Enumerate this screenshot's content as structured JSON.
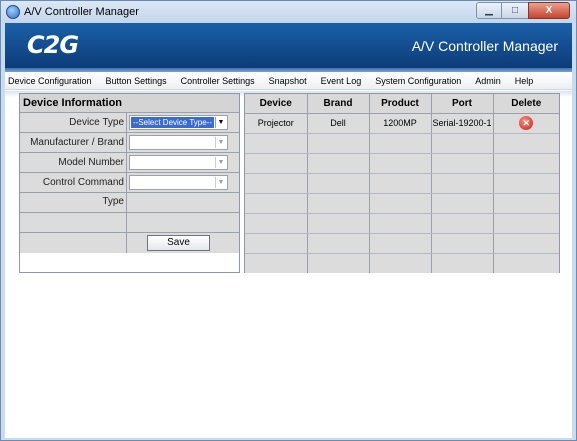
{
  "window": {
    "title": "A/V Controller Manager",
    "buttons": {
      "minimize": "▁",
      "maximize": "□",
      "close": "X"
    }
  },
  "banner": {
    "logo": "C2G",
    "title": "A/V Controller Manager"
  },
  "menu": [
    "Device Configuration",
    "Button Settings",
    "Controller Settings",
    "Snapshot",
    "Event Log",
    "System Configuration",
    "Admin",
    "Help"
  ],
  "device_info": {
    "title": "Device Information",
    "device_type_label": "Device Type",
    "device_type_value": "--Select Device Type--",
    "manufacturer_label": "Manufacturer / Brand",
    "manufacturer_value": "",
    "model_label": "Model Number",
    "model_value": "",
    "command_type_label": "Control Command Type",
    "command_type_value": "",
    "save_label": "Save"
  },
  "devices": {
    "headers": [
      "Device",
      "Brand",
      "Product",
      "Port",
      "Delete"
    ],
    "rows": [
      {
        "device": "Projector",
        "brand": "Dell",
        "product": "1200MP",
        "port": "Serial-19200-1",
        "delete_icon": "delete-icon"
      }
    ]
  },
  "colors": {
    "banner": "#1a60a8",
    "panel_bg": "#dcdcdc",
    "selection": "#3a6bd3",
    "delete": "#c8201a"
  }
}
